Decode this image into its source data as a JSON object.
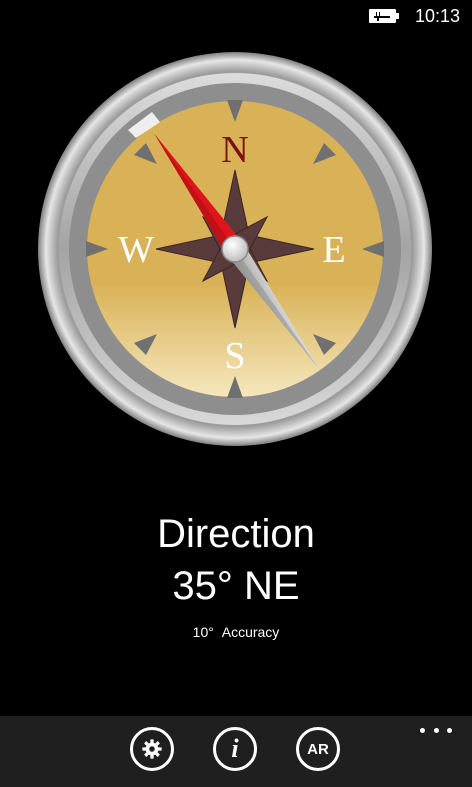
{
  "status_bar": {
    "time": "10:13",
    "battery_icon": "battery-charging-icon"
  },
  "compass": {
    "cardinals": {
      "north": "N",
      "east": "E",
      "south": "S",
      "west": "W"
    },
    "heading_degrees": 35,
    "colors": {
      "dial": "#d9b257",
      "dial_light": "#f2e2ae",
      "north_needle": "#e0141b",
      "south_needle": "#c8c8c8",
      "rose": "#5a3b3b",
      "north_letter": "#7a1010",
      "bezel": "#bdbdbd"
    }
  },
  "readout": {
    "title": "Direction",
    "heading": "35°",
    "direction": "NE",
    "accuracy_value": "10°",
    "accuracy_label": "Accuracy"
  },
  "app_bar": {
    "buttons": [
      {
        "icon": "gear-icon"
      },
      {
        "label": "i",
        "icon": "info-icon"
      },
      {
        "label": "AR",
        "icon": "ar-icon"
      }
    ],
    "more_icon": "ellipsis-icon"
  }
}
